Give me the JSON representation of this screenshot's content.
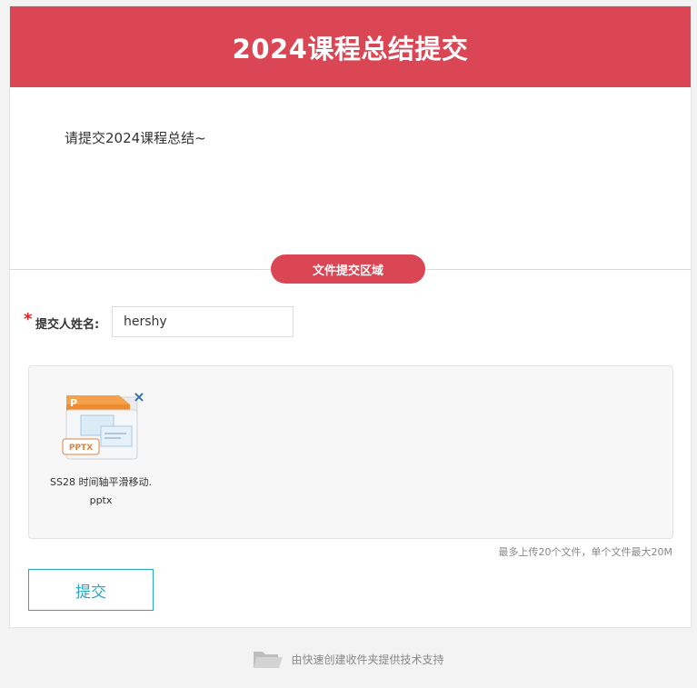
{
  "header": {
    "title": "2024课程总结提交"
  },
  "description": "请提交2024课程总结~",
  "section": {
    "title": "文件提交区域"
  },
  "form": {
    "required_mark": "*",
    "name_label": "提交人姓名:",
    "name_value": "hershy"
  },
  "upload": {
    "files": [
      {
        "name": "SS28 时间轴平滑移动.pptx",
        "type_badge": "PPTX",
        "icon": "pptx-file-icon",
        "remove_icon": "×"
      }
    ],
    "limit_note": "最多上传20个文件，单个文件最大20M"
  },
  "submit": {
    "label": "提交"
  },
  "footer": {
    "text": "由快速创建收件夹提供技术支持",
    "icon": "folder-icon"
  },
  "colors": {
    "brand_red": "#db4654",
    "accent_teal": "#29a9c0",
    "remove_blue": "#2f6fb1",
    "required_red": "#e02020"
  }
}
